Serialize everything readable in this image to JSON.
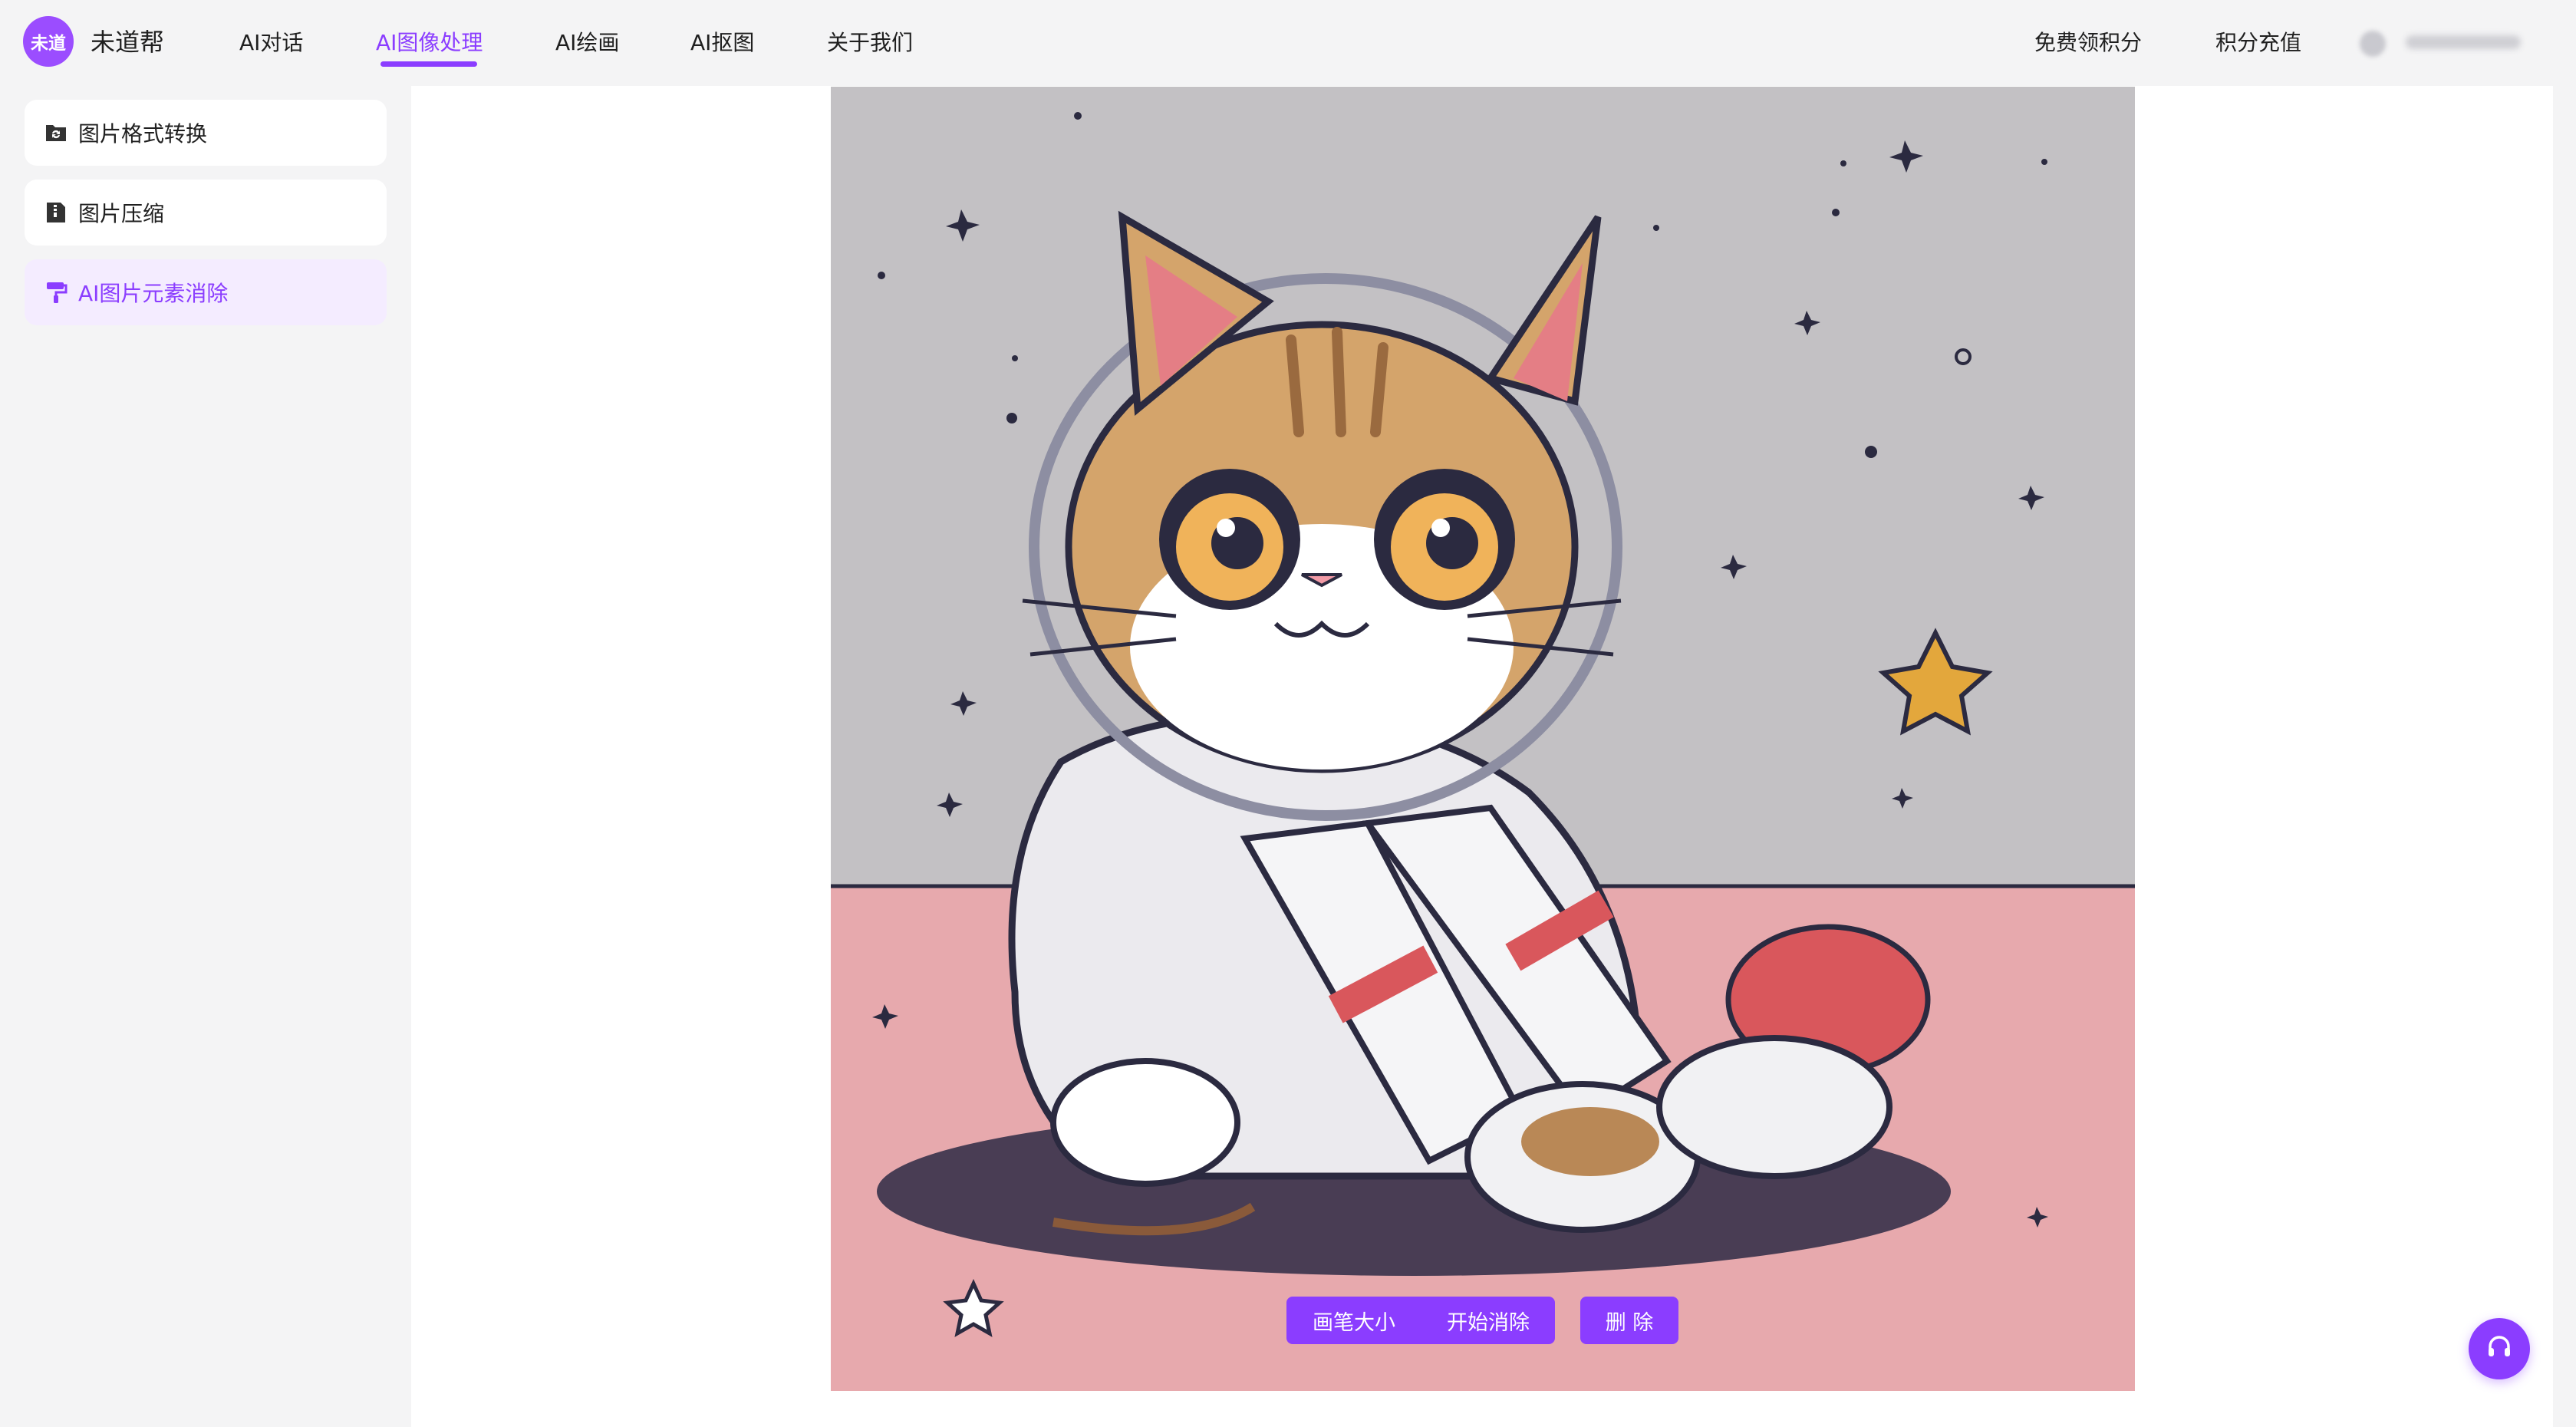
{
  "header": {
    "logo_badge": "未道",
    "logo_text": "未道帮",
    "nav": [
      {
        "label": "AI对话"
      },
      {
        "label": "AI图像处理",
        "active": true
      },
      {
        "label": "AI绘画"
      },
      {
        "label": "AI抠图"
      },
      {
        "label": "关于我们"
      }
    ],
    "free_points": "免费领积分",
    "recharge": "积分充值"
  },
  "sidebar": {
    "items": [
      {
        "label": "图片格式转换",
        "icon": "folder-convert-icon"
      },
      {
        "label": "图片压缩",
        "icon": "compress-icon"
      },
      {
        "label": "AI图片元素消除",
        "icon": "paint-roller-icon",
        "active": true
      }
    ]
  },
  "toolbar": {
    "brush_size": "画笔大小",
    "start_erase": "开始消除",
    "delete": "删 除"
  },
  "colors": {
    "accent": "#8b3dff",
    "active_bg": "#f4ecff",
    "canvas_wall": "#c3c1c4",
    "canvas_floor": "#e7a9ad"
  },
  "canvas_image": "cartoon cat in astronaut suit",
  "support_icon": "headset-icon"
}
